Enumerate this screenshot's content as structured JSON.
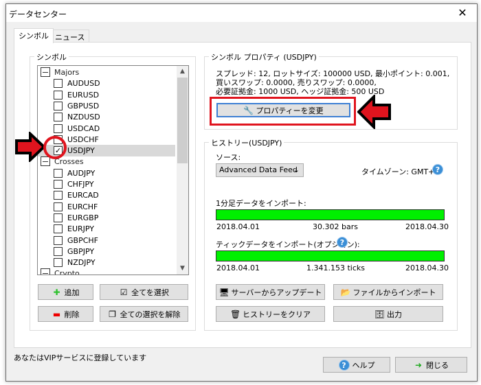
{
  "window": {
    "title": "データセンター",
    "close_icon": "close-icon"
  },
  "tabs": [
    {
      "label": "シンボル",
      "active": true
    },
    {
      "label": "ニュース",
      "active": false
    }
  ],
  "symbols": {
    "group_label": "シンボル",
    "tree": [
      {
        "type": "group",
        "label": "Majors"
      },
      {
        "type": "item",
        "label": "AUDUSD",
        "checked": false
      },
      {
        "type": "item",
        "label": "EURUSD",
        "checked": false
      },
      {
        "type": "item",
        "label": "GBPUSD",
        "checked": false
      },
      {
        "type": "item",
        "label": "NZDUSD",
        "checked": false
      },
      {
        "type": "item",
        "label": "USDCAD",
        "checked": false
      },
      {
        "type": "item",
        "label": "USDCHF",
        "checked": false
      },
      {
        "type": "item",
        "label": "USDJPY",
        "checked": true,
        "selected": true
      },
      {
        "type": "group",
        "label": "Crosses"
      },
      {
        "type": "item",
        "label": "AUDJPY",
        "checked": false
      },
      {
        "type": "item",
        "label": "CHFJPY",
        "checked": false
      },
      {
        "type": "item",
        "label": "EURCAD",
        "checked": false
      },
      {
        "type": "item",
        "label": "EURCHF",
        "checked": false
      },
      {
        "type": "item",
        "label": "EURGBP",
        "checked": false
      },
      {
        "type": "item",
        "label": "EURJPY",
        "checked": false
      },
      {
        "type": "item",
        "label": "GBPCHF",
        "checked": false
      },
      {
        "type": "item",
        "label": "GBPJPY",
        "checked": false
      },
      {
        "type": "item",
        "label": "NZDJPY",
        "checked": false
      },
      {
        "type": "group",
        "label": "Crypto"
      }
    ],
    "buttons": {
      "add": "追加",
      "select_all": "全てを選択",
      "delete": "削除",
      "deselect_all": "全ての選択を解除"
    }
  },
  "properties": {
    "group_label": "シンボル プロパティ (USDJPY)",
    "line1": "スプレッド: 12, ロットサイズ: 100000 USD, 最小ポイント: 0.001,",
    "line2": "買いスワップ: 0.0000, 売りスワップ: 0.0000,",
    "line3": "必要証拠金: 1000 USD, ヘッジ証拠金: 500 USD",
    "change_button": "プロパティーを変更"
  },
  "history": {
    "group_label": "ヒストリー(USDJPY)",
    "source_label": "ソース:",
    "source_value": "Advanced Data Feed",
    "timezone": "タイムゾーン: GMT+0",
    "m1_label": "1分足データをインポート:",
    "m1_progress_percent": 100,
    "m1_start": "2018.04.01",
    "m1_count": "30.302 bars",
    "m1_end": "2018.04.30",
    "tick_label": "ティックデータをインポート(オプション):",
    "tick_progress_percent": 100,
    "tick_start": "2018.04.01",
    "tick_count": "1.341.153 ticks",
    "tick_end": "2018.04.30",
    "buttons": {
      "update_server": "サーバーからアップデート",
      "import_file": "ファイルからインポート",
      "clear": "ヒストリーをクリア",
      "export": "出力"
    }
  },
  "footer": {
    "status": "あなたはVIPサービスに登録しています",
    "help": "ヘルプ",
    "close": "閉じる"
  },
  "colors": {
    "progress": "#00f000",
    "annotation": "#e0141e"
  }
}
